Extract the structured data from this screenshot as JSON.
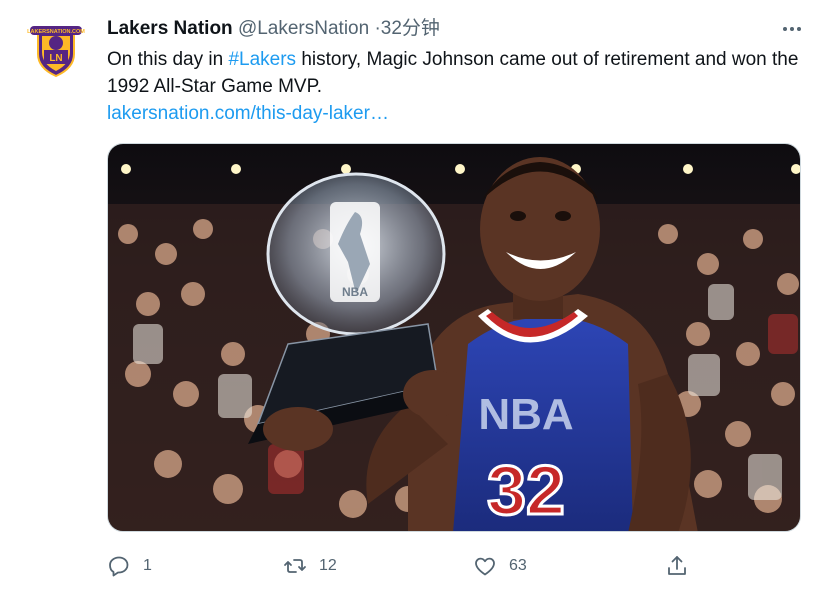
{
  "tweet": {
    "author_name": "Lakers Nation",
    "handle": "@LakersNation",
    "separator": "·",
    "time": "32分钟",
    "text_before": "On this day in ",
    "hashtag": "#Lakers",
    "text_after": " history, Magic Johnson came out of retirement and won the 1992 All-Star Game MVP.",
    "link": "lakersnation.com/this-day-laker…",
    "media_overlay": {
      "trophy_logo": "NBA",
      "jersey_letters": "NBA",
      "jersey_number": "32"
    }
  },
  "actions": {
    "reply_count": "1",
    "retweet_count": "12",
    "like_count": "63"
  },
  "avatar": {
    "logo_text": "LN",
    "ribbon_text": "LAKERSNATION.COM"
  },
  "colors": {
    "accent": "#1d9bf0",
    "secondary_text": "#536471",
    "primary_text": "#0f1419",
    "lakers_purple": "#552583",
    "lakers_gold": "#fdb927",
    "jersey_blue": "#2b3fa8"
  },
  "icons": [
    "more-icon",
    "reply-icon",
    "retweet-icon",
    "like-icon",
    "share-icon"
  ]
}
